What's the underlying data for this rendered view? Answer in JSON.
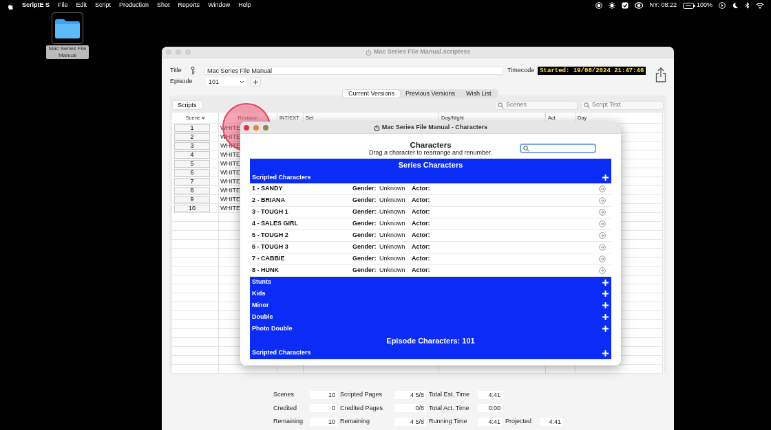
{
  "menubar": {
    "app": "ScriptE S",
    "menus": [
      "File",
      "Edit",
      "Script",
      "Production",
      "Shot",
      "Reports",
      "Window",
      "Help"
    ],
    "clock": "NY: 08:22",
    "battery": "100%"
  },
  "desktop_icon": {
    "label": "Mac Series File Manual"
  },
  "window": {
    "title": "Mac Series File Manual.scriptess"
  },
  "form": {
    "title_label": "Title",
    "title_value": "Mac Series File Manual",
    "episode_label": "Episode",
    "episode_value": "101",
    "timecode_label": "Timecode",
    "timecode_value": "Started: 19/08/2024 21:47:46"
  },
  "tabs": [
    {
      "label": "Current Versions",
      "selected": true
    },
    {
      "label": "Previous Versions",
      "selected": false
    },
    {
      "label": "Wish List",
      "selected": false
    }
  ],
  "scripts_button": "Scripts",
  "search_scenes": {
    "placeholder": "Scenes"
  },
  "search_text": {
    "placeholder": "Script Text"
  },
  "table": {
    "columns": [
      "Scene #",
      "Revision",
      "INT/EXT",
      "Set",
      "Day/Night",
      "Act",
      "Day"
    ],
    "rows": [
      {
        "scene": "1",
        "revision": "WHITE"
      },
      {
        "scene": "2",
        "revision": "WHITE"
      },
      {
        "scene": "3",
        "revision": "WHITE"
      },
      {
        "scene": "4",
        "revision": "WHITE"
      },
      {
        "scene": "5",
        "revision": "WHITE"
      },
      {
        "scene": "6",
        "revision": "WHITE"
      },
      {
        "scene": "7",
        "revision": "WHITE"
      },
      {
        "scene": "8",
        "revision": "WHITE"
      },
      {
        "scene": "9",
        "revision": "WHITE"
      },
      {
        "scene": "10",
        "revision": "WHITE"
      }
    ]
  },
  "stats": [
    [
      {
        "label": "Scenes",
        "value": "10"
      },
      {
        "label": "Scripted Pages",
        "value": "4 5/8"
      },
      {
        "label": "Total Est. Time",
        "value": "4:41"
      }
    ],
    [
      {
        "label": "Credited",
        "value": "0"
      },
      {
        "label": "Credited Pages",
        "value": "0/8"
      },
      {
        "label": "Total Act. Time",
        "value": "0:00"
      }
    ],
    [
      {
        "label": "Remaining",
        "value": "10"
      },
      {
        "label": "Remaining",
        "value": "4 5/8"
      },
      {
        "label": "Running Time",
        "value": "4:41"
      },
      {
        "label": "Projected",
        "value": "4:41"
      }
    ]
  ],
  "characters_dialog": {
    "title": "Mac Series File Manual - Characters",
    "heading": "Characters",
    "subtitle": "Drag a character to rearrange and renumber.",
    "items": [
      {
        "kind": "header",
        "label": "Series Characters"
      },
      {
        "kind": "section",
        "label": "Scripted Characters"
      },
      {
        "kind": "character",
        "name": "1 - SANDY",
        "gender_label": "Gender:",
        "gender": "Unknown",
        "actor_label": "Actor:"
      },
      {
        "kind": "character",
        "name": "2 - BRIANA",
        "gender_label": "Gender:",
        "gender": "Unknown",
        "actor_label": "Actor:"
      },
      {
        "kind": "character",
        "name": "3 - TOUGH 1",
        "gender_label": "Gender:",
        "gender": "Unknown",
        "actor_label": "Actor:"
      },
      {
        "kind": "character",
        "name": "4 - SALES GIRL",
        "gender_label": "Gender:",
        "gender": "Unknown",
        "actor_label": "Actor:"
      },
      {
        "kind": "character",
        "name": "5 - TOUGH 2",
        "gender_label": "Gender:",
        "gender": "Unknown",
        "actor_label": "Actor:"
      },
      {
        "kind": "character",
        "name": "6 - TOUGH 3",
        "gender_label": "Gender:",
        "gender": "Unknown",
        "actor_label": "Actor:"
      },
      {
        "kind": "character",
        "name": "7 - CABBIE",
        "gender_label": "Gender:",
        "gender": "Unknown",
        "actor_label": "Actor:"
      },
      {
        "kind": "character",
        "name": "8 - HUNK",
        "gender_label": "Gender:",
        "gender": "Unknown",
        "actor_label": "Actor:"
      },
      {
        "kind": "section",
        "label": "Stunts"
      },
      {
        "kind": "section",
        "label": "Kids"
      },
      {
        "kind": "section",
        "label": "Minor"
      },
      {
        "kind": "section",
        "label": "Double"
      },
      {
        "kind": "section",
        "label": "Photo Double"
      },
      {
        "kind": "header",
        "label": "Episode Characters: 101"
      },
      {
        "kind": "section",
        "label": "Scripted Characters"
      }
    ]
  }
}
